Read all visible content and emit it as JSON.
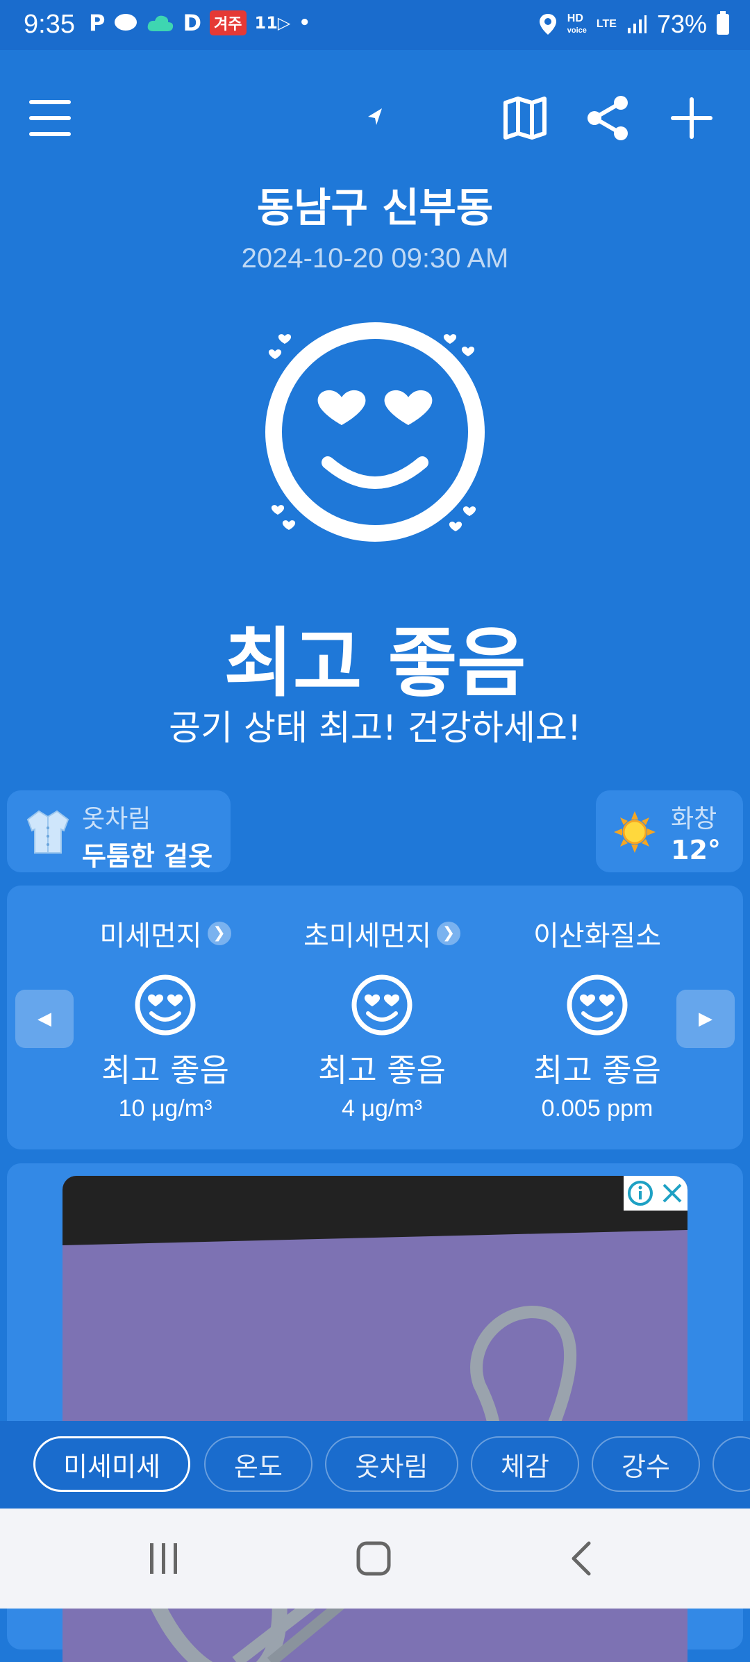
{
  "status_bar": {
    "time": "9:35",
    "left_icons": [
      "p-icon",
      "chat-icon",
      "cloud-icon",
      "d-app-icon",
      "news-app-icon",
      "notification-icon",
      "dot"
    ],
    "news_badge": "겨주",
    "small_text": "11▷",
    "hd_label": "HD",
    "voice_label": "voice",
    "lte_label": "LTE",
    "battery": "73%"
  },
  "header": {
    "location": "동남구 신부동",
    "datetime": "2024-10-20 09:30 AM"
  },
  "main": {
    "status": "최고 좋음",
    "message": "공기 상태 최고! 건강하세요!"
  },
  "info_cards": {
    "clothing": {
      "label": "옷차림",
      "value": "두툼한 겉옷"
    },
    "weather": {
      "label": "화창",
      "value": "12°"
    }
  },
  "pollutants": [
    {
      "name": "미세먼지",
      "status": "최고 좋음",
      "value": "10 μg/m³"
    },
    {
      "name": "초미세먼지",
      "status": "최고 좋음",
      "value": "4 μg/m³"
    },
    {
      "name": "이산화질소",
      "status": "최고 좋음",
      "value": "0.005 ppm"
    }
  ],
  "tabs": [
    "미세미세",
    "온도",
    "옷차림",
    "체감",
    "강수"
  ],
  "colors": {
    "background": "#1f78d8",
    "card": "#3389e6",
    "ad_background": "#7d72b3"
  }
}
